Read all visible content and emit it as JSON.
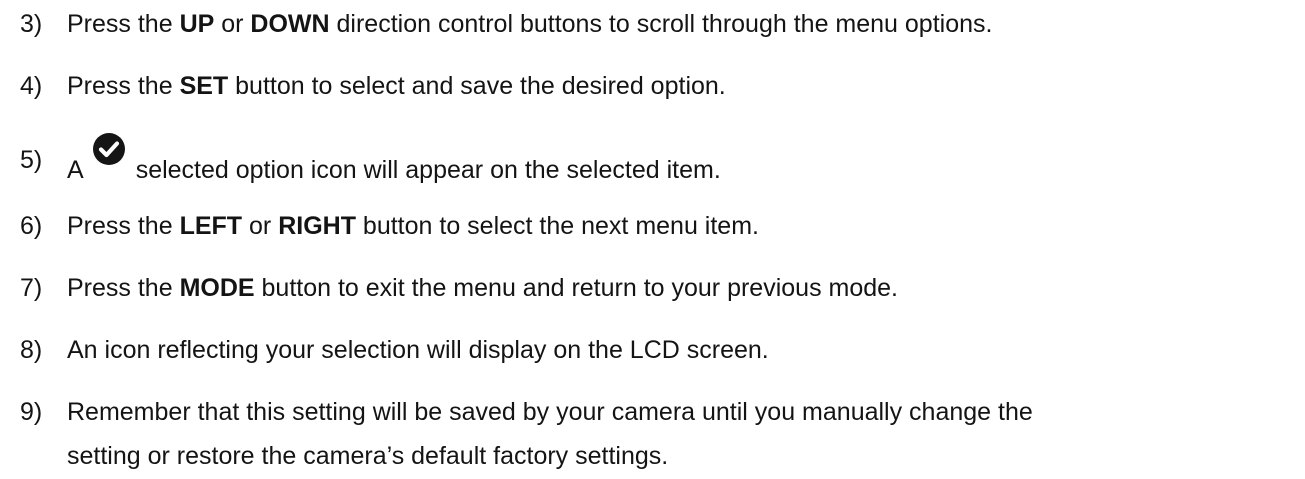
{
  "steps": [
    {
      "number": "3)",
      "parts": [
        "Press the ",
        "UP",
        " or ",
        "DOWN",
        " direction control buttons to scroll through the menu options."
      ]
    },
    {
      "number": "4)",
      "parts": [
        "Press the ",
        "SET",
        " button to select and save the desired option."
      ]
    },
    {
      "number": "5)",
      "pre": "A",
      "icon": "check-circle-icon",
      "post": "selected option icon will appear on the selected item."
    },
    {
      "number": "6)",
      "parts": [
        "Press the ",
        "LEFT",
        " or ",
        "RIGHT",
        " button to select the next menu item."
      ]
    },
    {
      "number": "7)",
      "parts": [
        "Press the ",
        "MODE",
        " button to exit the menu and return to your previous mode."
      ]
    },
    {
      "number": "8)",
      "text": "An icon reflecting your selection will display on the LCD screen."
    },
    {
      "number": "9)",
      "text": "Remember that this setting will be saved by your camera until you manually change the",
      "continuation": "setting or restore the camera’s default factory settings."
    }
  ]
}
